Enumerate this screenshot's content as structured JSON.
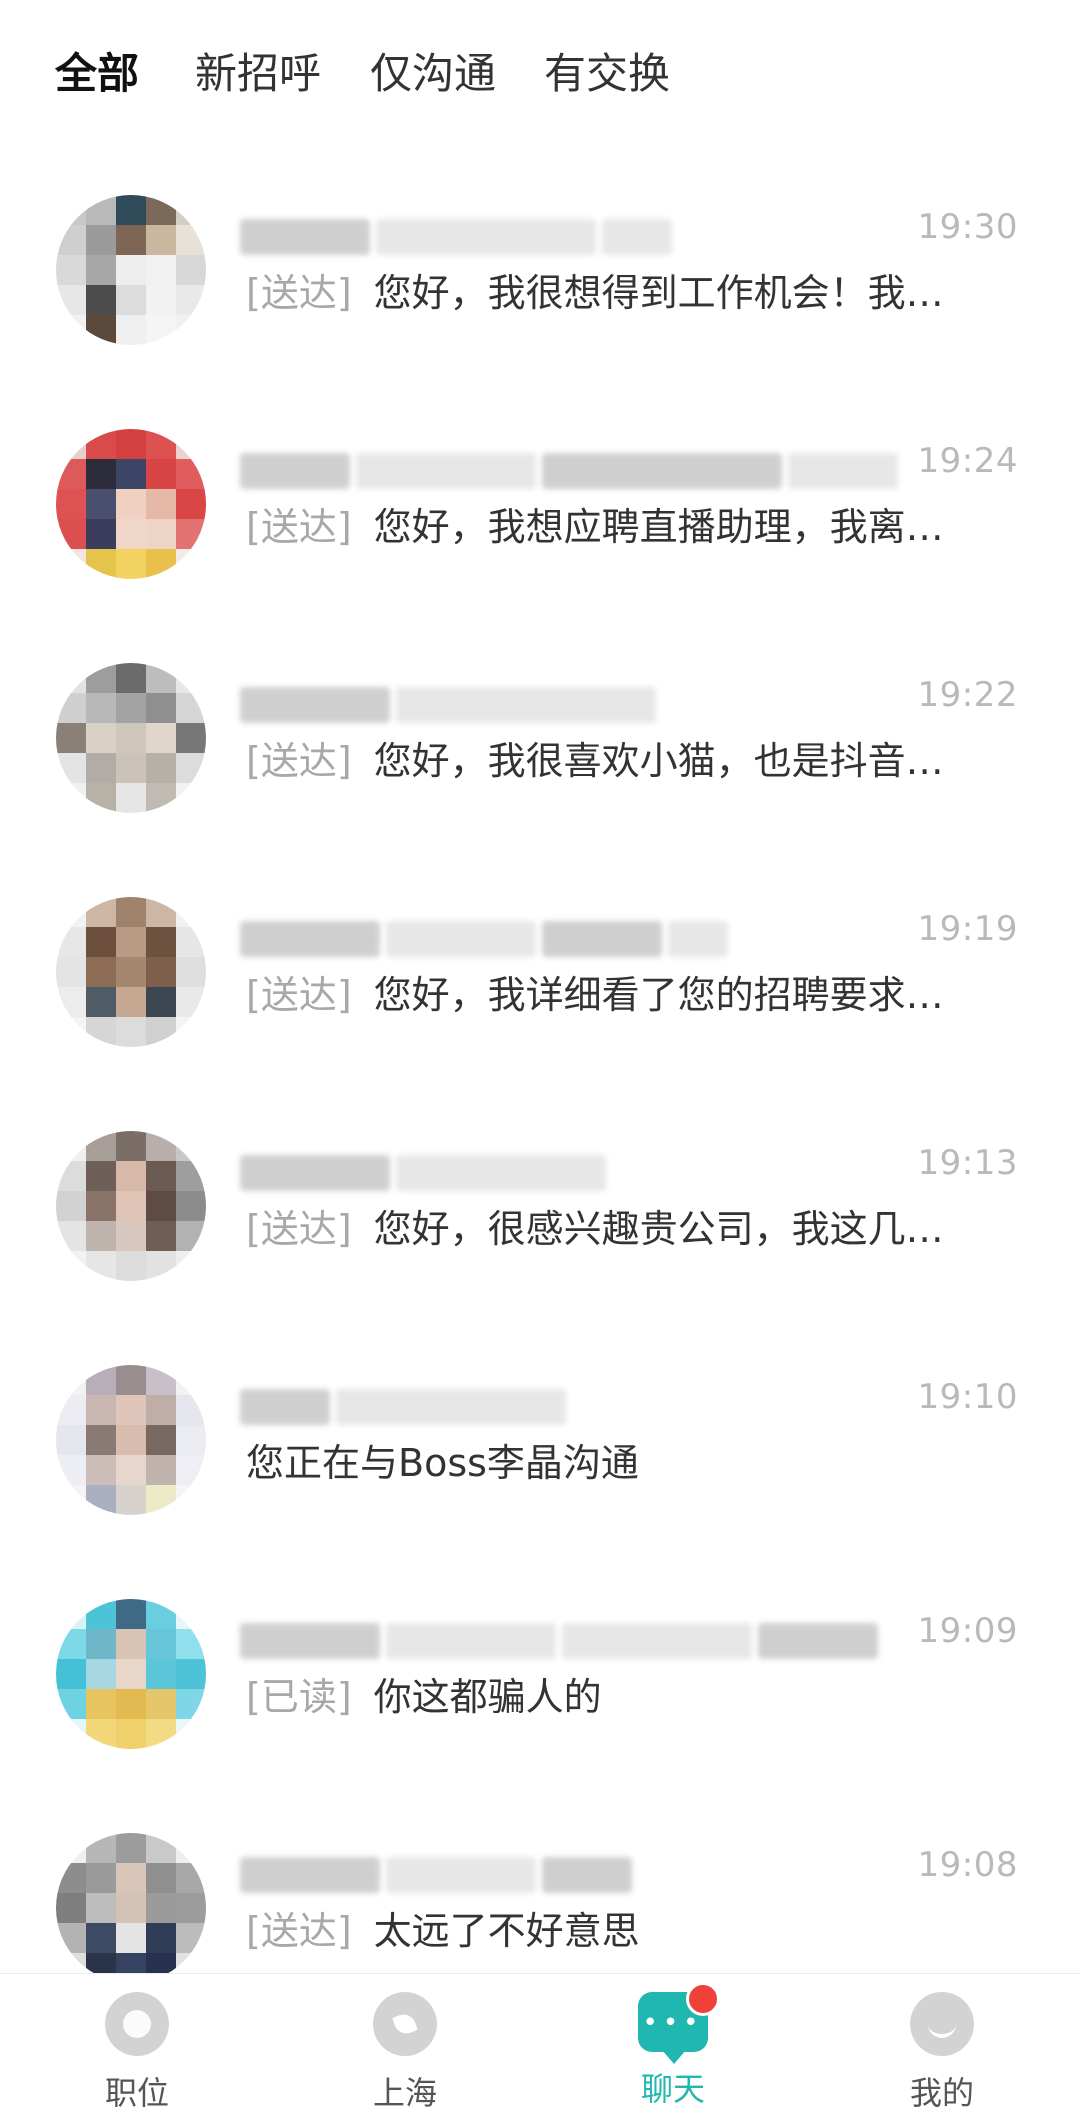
{
  "tabs": [
    {
      "label": "全部",
      "active": true
    },
    {
      "label": "新招呼",
      "active": false
    },
    {
      "label": "仅沟通",
      "active": false
    },
    {
      "label": "有交换",
      "active": false
    }
  ],
  "conversations": [
    {
      "time": "19:30",
      "status": "[送达]",
      "message": "您好，我很想得到工作机会！我…"
    },
    {
      "time": "19:24",
      "status": "[送达]",
      "message": "您好，我想应聘直播助理，我离…"
    },
    {
      "time": "19:22",
      "status": "[送达]",
      "message": "您好，我很喜欢小猫，也是抖音…"
    },
    {
      "time": "19:19",
      "status": "[送达]",
      "message": "您好，我详细看了您的招聘要求…"
    },
    {
      "time": "19:13",
      "status": "[送达]",
      "message": "您好，很感兴趣贵公司，我这几…"
    },
    {
      "time": "19:10",
      "status": "",
      "message": "您正在与Boss李晶沟通"
    },
    {
      "time": "19:09",
      "status": "[已读]",
      "message": "你这都骗人的"
    },
    {
      "time": "19:08",
      "status": "[送达]",
      "message": "太远了不好意思"
    }
  ],
  "bottom_nav": [
    {
      "label": "职位",
      "icon": "briefcase-icon",
      "active": false
    },
    {
      "label": "上海",
      "icon": "leaf-icon",
      "active": false
    },
    {
      "label": "聊天",
      "icon": "chat-bubble-icon",
      "active": true
    },
    {
      "label": "我的",
      "icon": "profile-icon",
      "active": false
    }
  ],
  "colors": {
    "accent": "#1fb7b0",
    "badge": "#f0403a",
    "muted": "#b9b9b9"
  }
}
